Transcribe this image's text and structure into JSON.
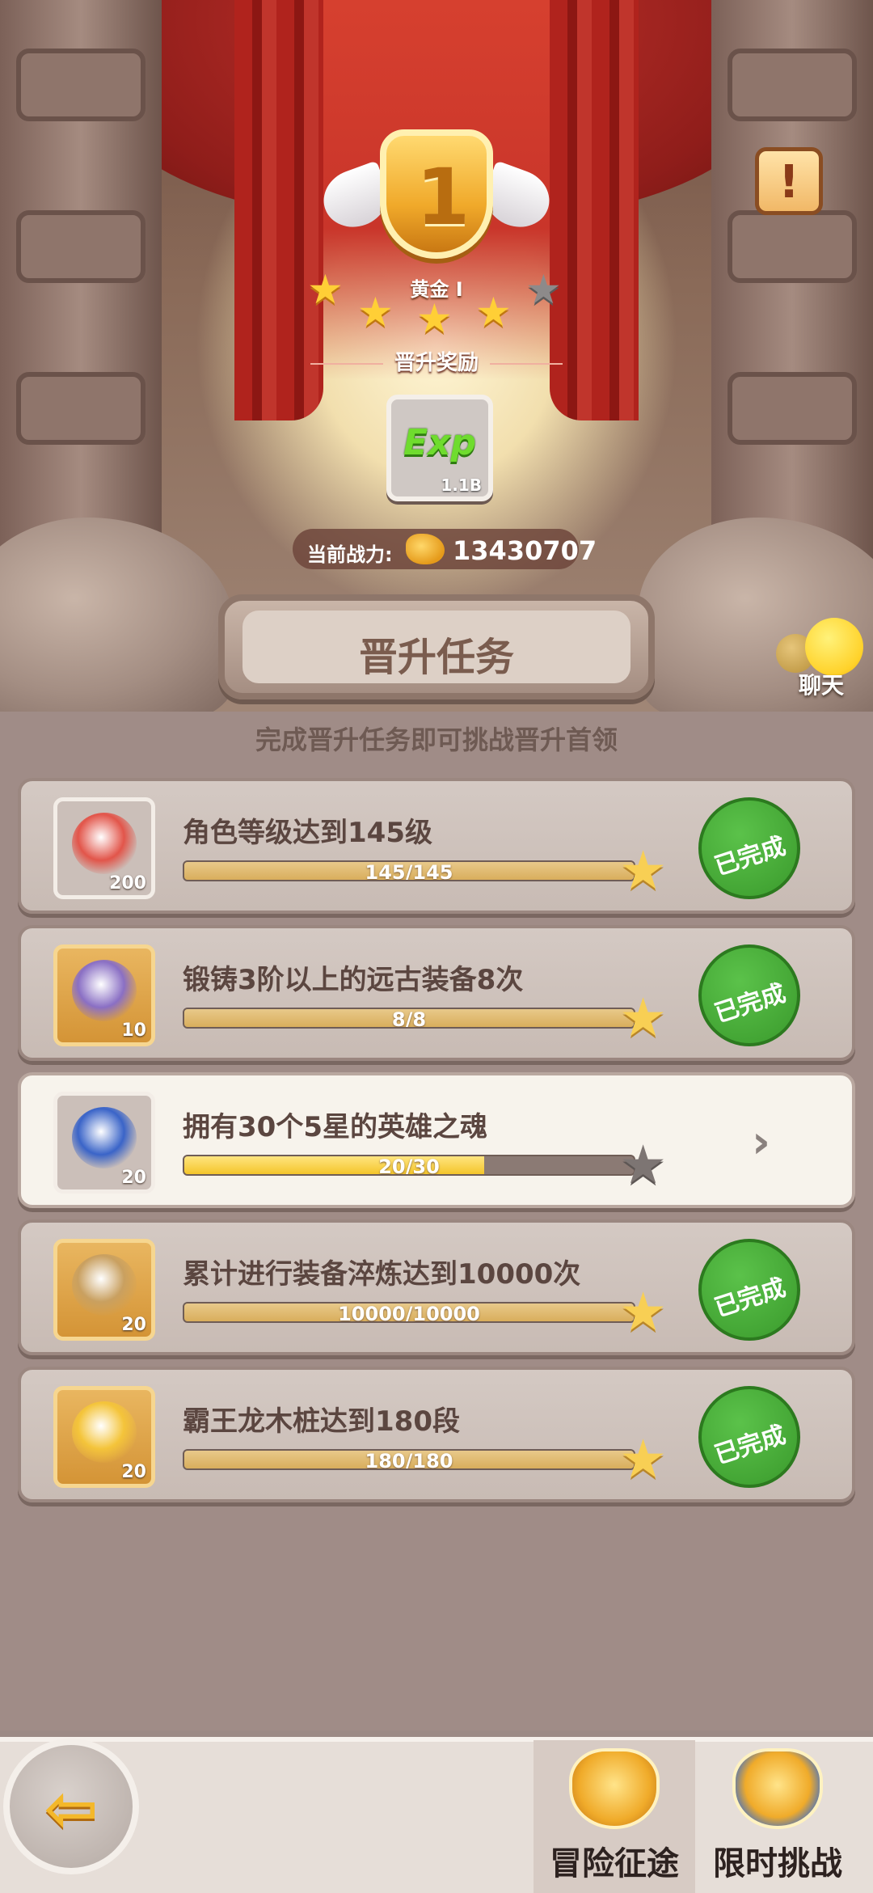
{
  "rank": {
    "number": "1",
    "name": "黄金 I",
    "stars_filled": 4,
    "stars_total": 5
  },
  "reward": {
    "section_title": "晋升奖励",
    "item_label": "Exp",
    "item_amount": "1.1B"
  },
  "power": {
    "label": "当前战力:",
    "value": "13430707"
  },
  "info_button": {
    "label": "!"
  },
  "header": {
    "title": "晋升任务",
    "subtitle": "完成晋升任务即可挑战晋升首领"
  },
  "chat": {
    "label": "聊天"
  },
  "tasks": [
    {
      "title": "角色等级达到145级",
      "progress_text": "145/145",
      "progress": 1.0,
      "count": "200",
      "status": "已完成",
      "icon": "starfish-icon"
    },
    {
      "title": "锻铸3阶以上的远古装备8次",
      "progress_text": "8/8",
      "progress": 1.0,
      "count": "10",
      "status": "已完成",
      "icon": "bag-icon"
    },
    {
      "title": "拥有30个5星的英雄之魂",
      "progress_text": "20/30",
      "progress": 0.6667,
      "count": "20",
      "status": "",
      "icon": "crystal-icon"
    },
    {
      "title": "累计进行装备淬炼达到10000次",
      "progress_text": "10000/10000",
      "progress": 1.0,
      "count": "20",
      "status": "已完成",
      "icon": "statue-icon"
    },
    {
      "title": "霸王龙木桩达到180段",
      "progress_text": "180/180",
      "progress": 1.0,
      "count": "20",
      "status": "已完成",
      "icon": "gold-idol-icon"
    }
  ],
  "nav": {
    "back_label": "⇦",
    "tab1": "冒险征途",
    "tab2": "限时挑战"
  },
  "colors": {
    "accent_gold": "#f0ab2a",
    "done_green": "#3a9a2c",
    "curtain_red": "#c2322b"
  }
}
